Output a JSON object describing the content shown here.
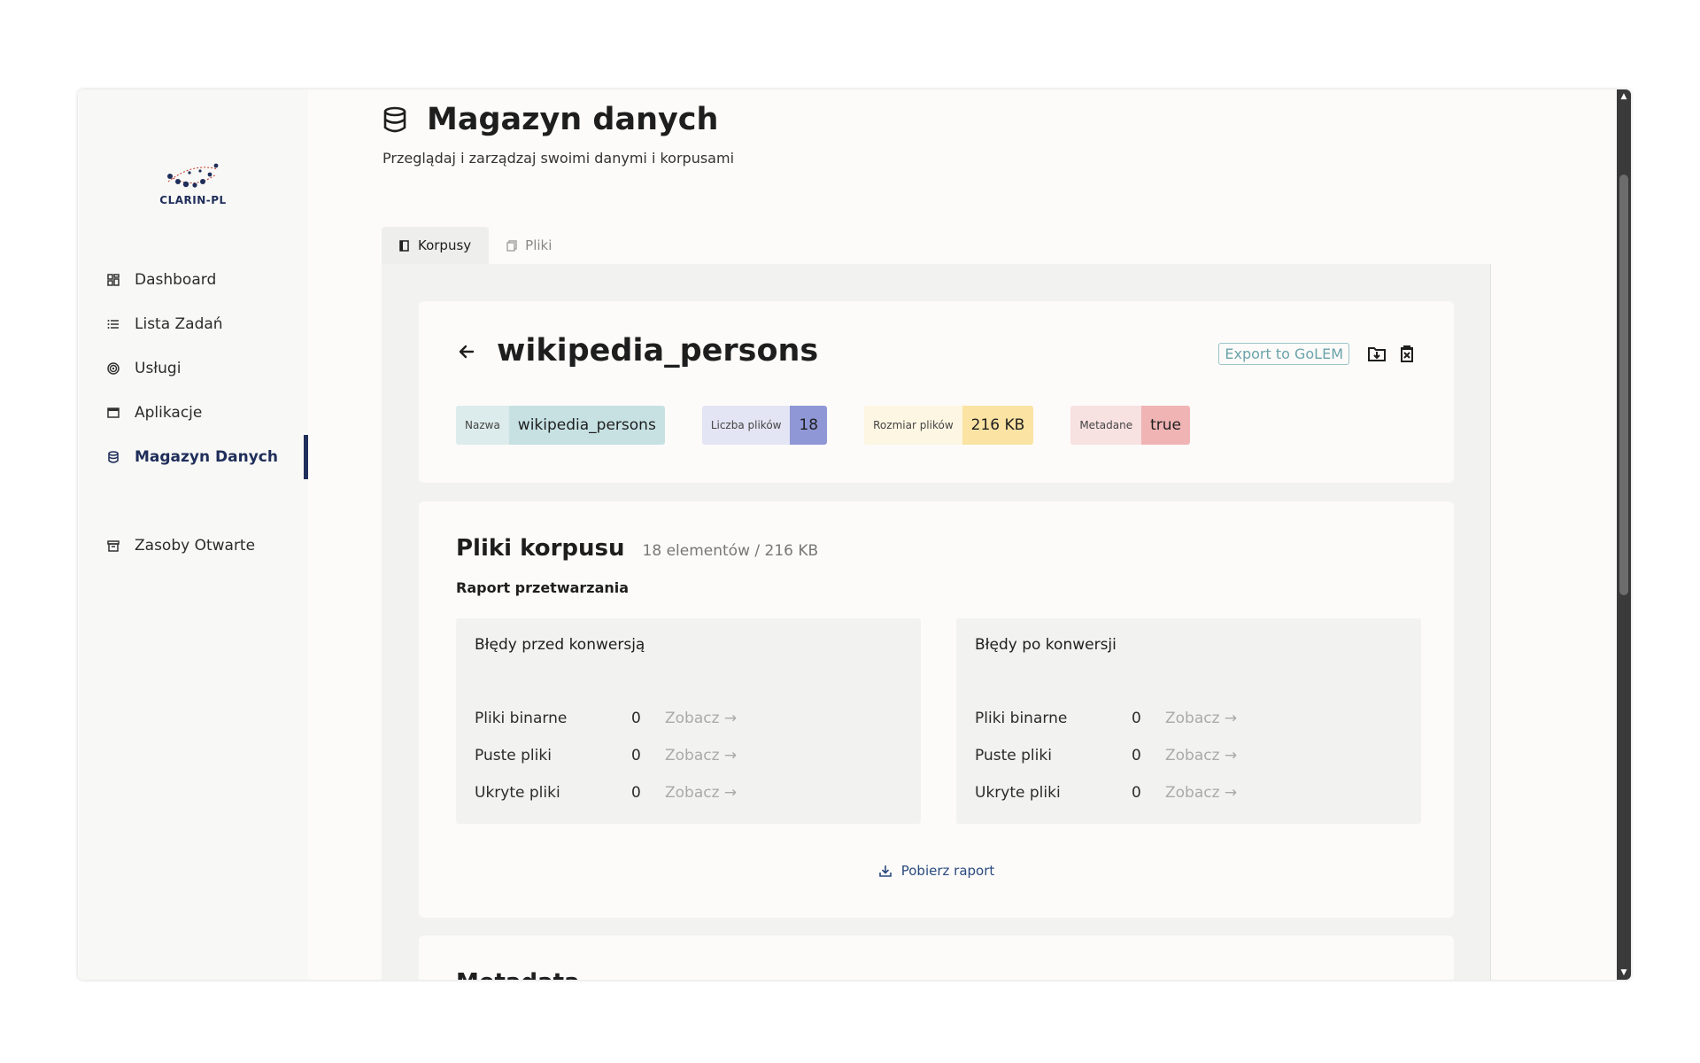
{
  "sidebar": {
    "logo_text": "CLARIN-PL",
    "items": [
      {
        "label": "Dashboard",
        "icon": "dashboard-icon"
      },
      {
        "label": "Lista Zadań",
        "icon": "list-icon"
      },
      {
        "label": "Usługi",
        "icon": "target-icon"
      },
      {
        "label": "Aplikacje",
        "icon": "window-icon"
      },
      {
        "label": "Magazyn Danych",
        "icon": "database-icon",
        "active": true
      },
      {
        "label": "Zasoby Otwarte",
        "icon": "archive-icon"
      }
    ]
  },
  "header": {
    "title": "Magazyn danych",
    "subtitle": "Przeglądaj i zarządzaj swoimi danymi i korpusami"
  },
  "tabs": [
    {
      "label": "Korpusy",
      "active": true
    },
    {
      "label": "Pliki",
      "active": false
    }
  ],
  "corpus": {
    "name": "wikipedia_persons",
    "export_label": "Export to GoLEM",
    "badges": [
      {
        "label": "Nazwa",
        "value": "wikipedia_persons"
      },
      {
        "label": "Liczba plików",
        "value": "18"
      },
      {
        "label": "Rozmiar plików",
        "value": "216 KB"
      },
      {
        "label": "Metadane",
        "value": "true"
      }
    ]
  },
  "files": {
    "title": "Pliki korpusu",
    "count": "18 elementów / 216 KB",
    "report_label": "Raport przetwarzania",
    "before": {
      "title": "Błędy przed konwersją",
      "rows": [
        {
          "name": "Pliki binarne",
          "count": "0",
          "link": "Zobacz →"
        },
        {
          "name": "Puste pliki",
          "count": "0",
          "link": "Zobacz →"
        },
        {
          "name": "Ukryte pliki",
          "count": "0",
          "link": "Zobacz →"
        }
      ]
    },
    "after": {
      "title": "Błędy po konwersji",
      "rows": [
        {
          "name": "Pliki binarne",
          "count": "0",
          "link": "Zobacz →"
        },
        {
          "name": "Puste pliki",
          "count": "0",
          "link": "Zobacz →"
        },
        {
          "name": "Ukryte pliki",
          "count": "0",
          "link": "Zobacz →"
        }
      ]
    },
    "download_label": "Pobierz raport"
  },
  "metadata": {
    "title": "Metadata"
  },
  "colors": {
    "accent": "#1f2e5a",
    "export": "#6aa3aa",
    "link": "#2a4a7f"
  }
}
